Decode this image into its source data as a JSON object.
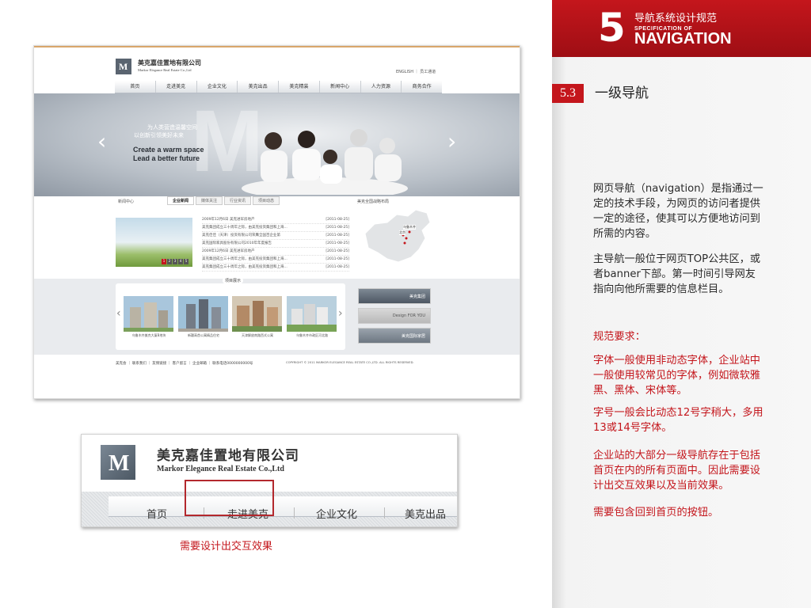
{
  "header": {
    "number": "5",
    "cn_title": "导航系统设计规范",
    "spec_label": "SPECIFICATION OF",
    "nav_label": "NAVIGATION",
    "accent_color": "#c4161c"
  },
  "section": {
    "number": "5.3",
    "title": "一级导航"
  },
  "body_text": {
    "p1": "网页导航（navigation）是指通过一定的技术手段，为网页的访问者提供一定的途径，使其可以方便地访问到所需的内容。",
    "p2": "主导航一般位于网页TOP公共区，或者banner下部。第一时间引导网友指向向他所需要的信息栏目。",
    "req_title": "规范要求：",
    "req1": "字体一般使用非动态字体，企业站中一般使用较常见的字体，例如微软雅黑、黑体、宋体等。",
    "req2": "字号一般会比动态12号字稍大，多用13或14号字体。",
    "req3": "企业站的大部分一级导航存在于包括首页在内的所有页面中。因此需要设计出交互效果以及当前效果。",
    "req4": "需要包含回到首页的按钮。"
  },
  "site": {
    "logo_letter": "M",
    "name_cn": "美克嘉佳置地有限公司",
    "name_en": "Markor Elegance Real Estate Co.,Ltd",
    "lang": "ENGLISH ｜ 员工通道",
    "nav": [
      "首页",
      "走进美克",
      "企业文化",
      "美克出品",
      "美克精装",
      "新闻中心",
      "人力资源",
      "商务合作"
    ],
    "banner": {
      "line1": "为人类营造温馨空间",
      "line2": "以创新引领美好未来",
      "line3": "Create a warm space",
      "line4": "Lead a better future"
    },
    "news_center": "新闻中心",
    "news_tabs": [
      "企业新闻",
      "媒体关注",
      "行业资讯",
      "项目动态"
    ],
    "map_title": "美克全国战略布局",
    "map_labels": [
      "乌鲁木齐",
      "北京"
    ],
    "news": [
      {
        "title": "2009年12月6日 美克进军房地产",
        "date": "[2011-08-25]"
      },
      {
        "title": "美克集团成立三十周年之际，由美克投资集团和上海...",
        "date": "[2011-08-25]"
      },
      {
        "title": "美克佳佳（天津）投资有限公司荣膺全国百企业第",
        "date": "[2011-08-25]"
      },
      {
        "title": "美克国际家具股份有限公司2010年年度报告",
        "date": "[2011-08-25]"
      },
      {
        "title": "2009年12月6日 美克进军房地产",
        "date": "[2011-08-25]"
      },
      {
        "title": "美克集团成立三十周年之际，由美克投资集团和上海...",
        "date": "[2011-08-25]"
      },
      {
        "title": "美克集团成立三十周年之际，由美克投资集团和上海...",
        "date": "[2011-08-25]"
      }
    ],
    "pager": [
      "1",
      "2",
      "3",
      "4",
      "5"
    ],
    "projects_title": "项目展示",
    "projects": [
      "乌鲁木齐美克大厦B地块",
      "新疆高首公寓精品住宅",
      "天津解放南路西式公寓",
      "乌鲁木齐市政区河北路"
    ],
    "side_banners": [
      "美克集团",
      "Design FOR YOU",
      "美克国际家居"
    ],
    "footer_links": "美克会 ｜ 联系我们 ｜ 友情链接 ｜ 客户留言 ｜ 企业邮箱 ｜ 联系电话0000000000号",
    "copyright": "COPYRIGHT © 2011 MARKOR ELEGANCE REAL ESTATE CO.,LTD. ALL RIGHTS RESERVED."
  },
  "zoom": {
    "name_cn": "美克嘉佳置地有限公司",
    "name_en": "Markor Elegance Real Estate Co.,Ltd",
    "nav": [
      "首页",
      "走进美克",
      "企业文化",
      "美克出品"
    ],
    "caption": "需要设计出交互效果"
  }
}
